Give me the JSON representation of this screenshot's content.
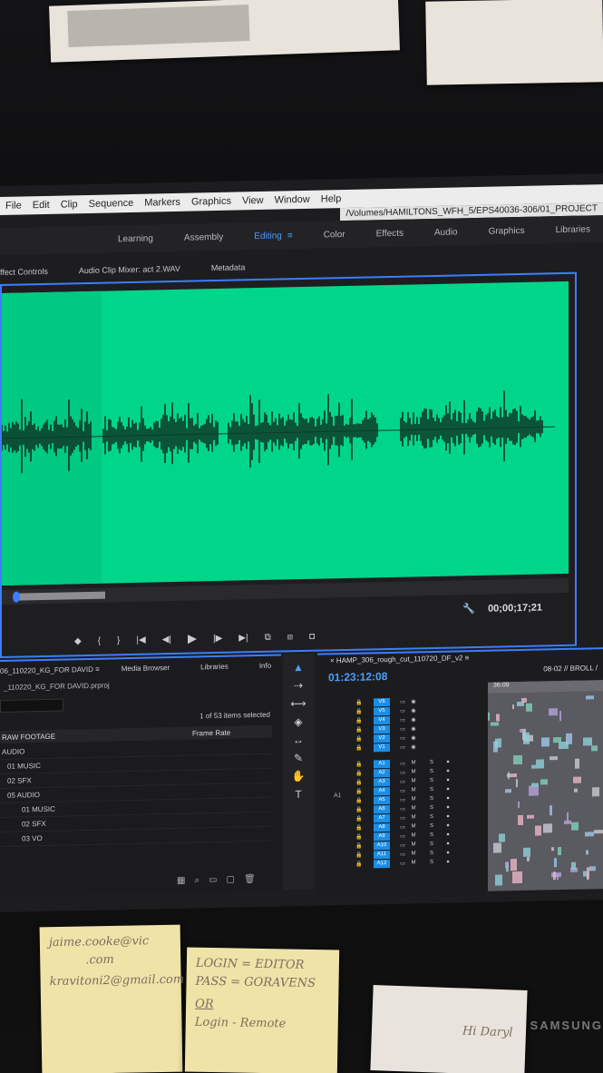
{
  "menu": [
    "File",
    "Edit",
    "Clip",
    "Sequence",
    "Markers",
    "Graphics",
    "View",
    "Window",
    "Help"
  ],
  "path": "/Volumes/HAMILTONS_WFH_5/EPS40036-306/01_PROJECT",
  "workspaces": [
    "Learning",
    "Assembly",
    "Editing",
    "Color",
    "Effects",
    "Audio",
    "Graphics",
    "Libraries"
  ],
  "source_tabs": [
    "ffect Controls",
    "Audio Clip Mixer: act 2.WAV",
    "Metadata"
  ],
  "source": {
    "timecode": "00;00;17;21"
  },
  "project": {
    "tabs": [
      "06_110220_KG_FOR DAVID ≡",
      "Media Browser",
      "Libraries",
      "Info"
    ],
    "file": "_110220_KG_FOR DAVID.prproj",
    "count": "1 of 53 items selected",
    "columns": [
      "RAW FOOTAGE",
      "Frame Rate"
    ],
    "items": [
      "AUDIO",
      "01 MUSIC",
      "02 SFX",
      "05 AUDIO",
      "01 MUSIC",
      "02 SFX",
      "03 VO"
    ]
  },
  "timeline": {
    "sequence": "× HAMP_306_rough_cut_110720_DF_v2 ≡",
    "timecode": "01:23:12:08",
    "right_label": "08-02 // BROLL /",
    "ruler": "36:09",
    "source_patch": "A1",
    "video_tracks": [
      "V6",
      "V5",
      "V4",
      "V3",
      "V2",
      "V1"
    ],
    "audio_tracks": [
      "A1",
      "A2",
      "A3",
      "A4",
      "A5",
      "A6",
      "A7",
      "A8",
      "A9",
      "A10",
      "A11",
      "A12"
    ],
    "mute_label": "M",
    "solo_label": "S"
  },
  "colors": {
    "waveform_bg": "#00d68a",
    "accent": "#3c7dff",
    "track_label": "#1a8ee6"
  },
  "notes": [
    [
      "jaime.cooke@vic",
      ".com",
      "kravitoni2@gmail.com"
    ],
    [
      "LOGIN = EDITOR",
      "PASS = GORAVENS",
      "OR",
      "Login - Remote"
    ],
    [
      "Hi Daryl"
    ]
  ],
  "brand": "SAMSUNG"
}
